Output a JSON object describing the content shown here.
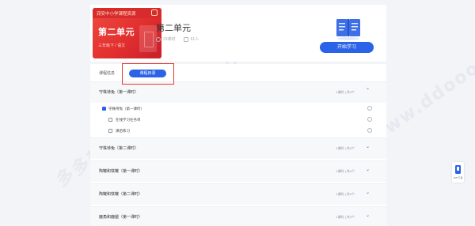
{
  "header": {
    "cover_brand": "润安中小学课程资源",
    "cover_title": "第二单元",
    "cover_subtitle": "三年级下 / 语文",
    "unit_title": "第二单元",
    "stats": [
      {
        "icon": "clock-icon",
        "text": "23课时"
      },
      {
        "icon": "user-icon",
        "text": "61人"
      }
    ],
    "start_button": "开始学习"
  },
  "tabs": {
    "intro": "课程信息",
    "catalog": "课程目录"
  },
  "sections": [
    {
      "title": "守株待兔（第一课时）",
      "meta": "1课时 | 共3个",
      "expanded": true,
      "lessons": [
        {
          "label": "守株待兔（第一课时）",
          "checkbox": "blue"
        },
        {
          "label": "在线学习任务单",
          "checkbox": "grey"
        },
        {
          "label": "课后练习",
          "checkbox": "grey"
        }
      ]
    },
    {
      "title": "守株待兔（第二课时）",
      "meta": "1课时 | 共3个",
      "expanded": false
    },
    {
      "title": "陶罐和铁罐（第一课时）",
      "meta": "1课时 | 共4个",
      "expanded": false
    },
    {
      "title": "陶罐和铁罐（第二课时）",
      "meta": "1课时 | 共4个",
      "expanded": false
    },
    {
      "title": "鹿角和鹿腿（第一课时）",
      "meta": "1课时 | 共3个",
      "expanded": false
    }
  ],
  "app_badge": "APP下载",
  "watermark": "多多软件站 www.ddooo.com",
  "colors": {
    "accent": "#2b62e6",
    "highlight_border": "#e53935",
    "cover_red": "#e22f2f",
    "page_bg": "#f2f4f7"
  }
}
